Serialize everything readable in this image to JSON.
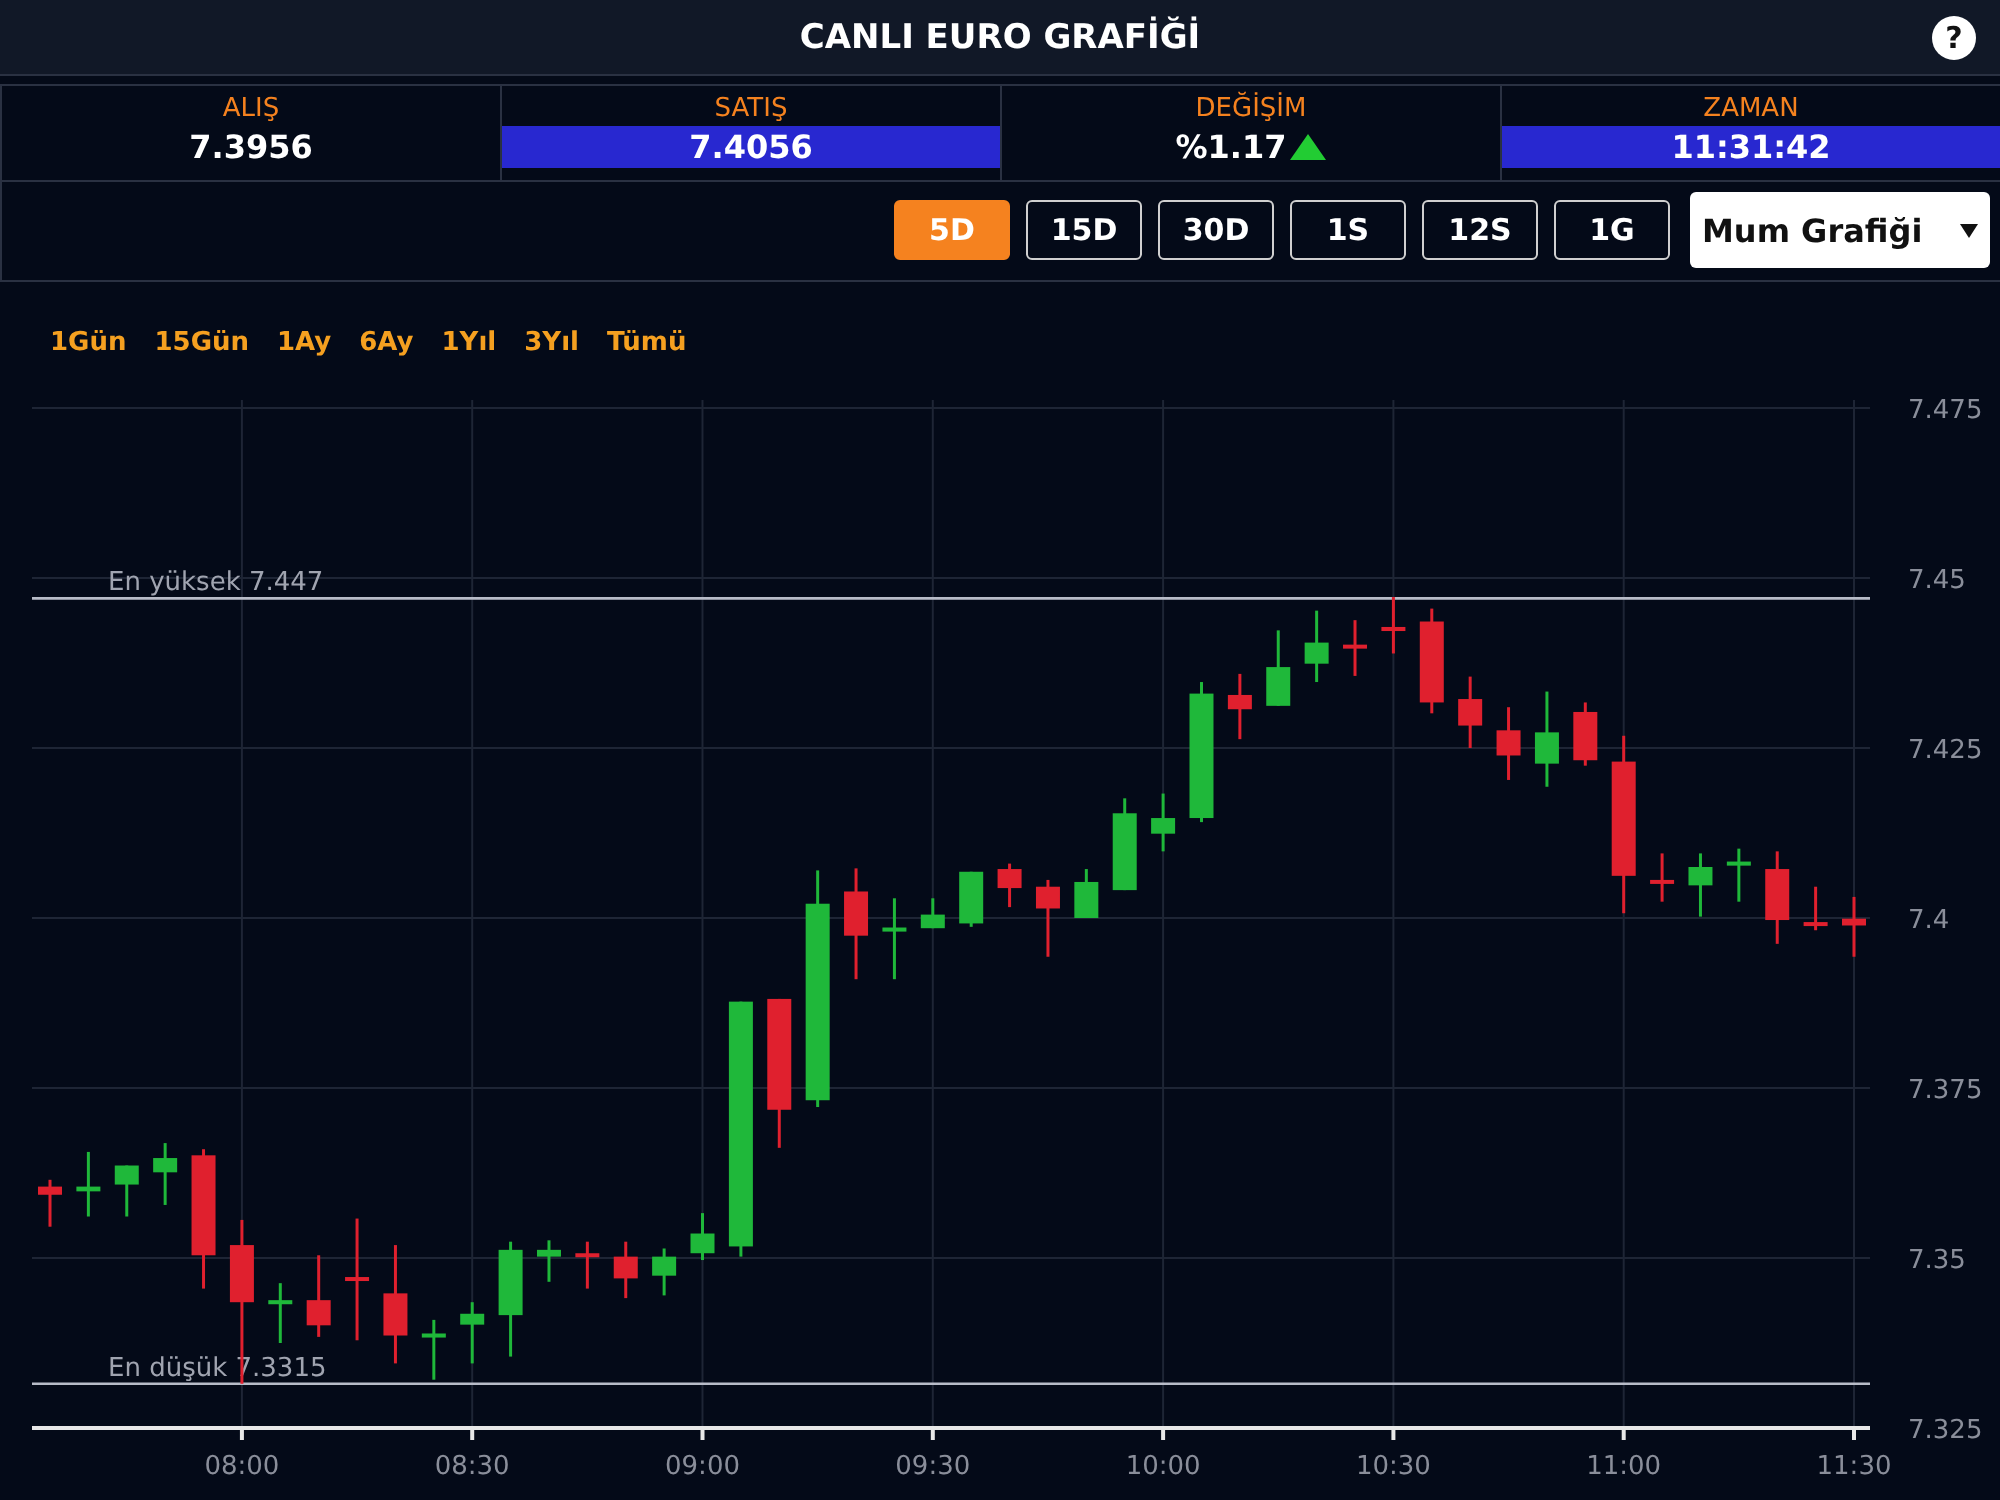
{
  "header": {
    "title": "CANLI EURO GRAFİĞİ",
    "help": "?"
  },
  "quotes": [
    {
      "label": "ALIŞ",
      "value": "7.3956",
      "highlighted": false
    },
    {
      "label": "SATIŞ",
      "value": "7.4056",
      "highlighted": true
    },
    {
      "label": "DEĞİŞİM",
      "value": "%1.17",
      "highlighted": false,
      "rising": true
    },
    {
      "label": "ZAMAN",
      "value": "11:31:42",
      "highlighted": true
    }
  ],
  "periods": [
    {
      "label": "5D",
      "selected": true
    },
    {
      "label": "15D",
      "selected": false
    },
    {
      "label": "30D",
      "selected": false
    },
    {
      "label": "1S",
      "selected": false
    },
    {
      "label": "12S",
      "selected": false
    },
    {
      "label": "1G",
      "selected": false
    }
  ],
  "chart_type": {
    "value": "Mum Grafiği"
  },
  "ranges": [
    "1Gün",
    "15Gün",
    "1Ay",
    "6Ay",
    "1Yıl",
    "3Yıl",
    "Tümü"
  ],
  "chart_data": {
    "type": "candlestick",
    "ylim": [
      7.325,
      7.475
    ],
    "grid": true,
    "categories": [
      null,
      null,
      null,
      null,
      null,
      "08:00",
      null,
      null,
      null,
      null,
      null,
      "08:30",
      null,
      null,
      null,
      null,
      null,
      "09:00",
      null,
      null,
      null,
      null,
      null,
      "09:30",
      null,
      null,
      null,
      null,
      null,
      "10:00",
      null,
      null,
      null,
      null,
      null,
      "10:30",
      null,
      null,
      null,
      null,
      null,
      "11:00",
      null,
      null,
      null,
      null,
      null,
      "11:30"
    ],
    "ohlc": [
      [
        7.3605,
        7.3615,
        7.3546,
        7.3593
      ],
      [
        7.3598,
        7.3656,
        7.3561,
        7.3605
      ],
      [
        7.3608,
        7.3636,
        7.3561,
        7.3636
      ],
      [
        7.3626,
        7.3669,
        7.3578,
        7.3647
      ],
      [
        7.3651,
        7.366,
        7.3455,
        7.3504
      ],
      [
        7.3519,
        7.3556,
        7.3315,
        7.3435
      ],
      [
        7.3432,
        7.3463,
        7.3375,
        7.3438
      ],
      [
        7.3438,
        7.3504,
        7.3384,
        7.3401
      ],
      [
        7.3472,
        7.3558,
        7.3379,
        7.3468
      ],
      [
        7.3448,
        7.3519,
        7.3345,
        7.3386
      ],
      [
        7.3383,
        7.3409,
        7.3321,
        7.3389
      ],
      [
        7.3402,
        7.3435,
        7.3345,
        7.3418
      ],
      [
        7.3416,
        7.3524,
        7.3355,
        7.3512
      ],
      [
        7.3502,
        7.3526,
        7.3465,
        7.3512
      ],
      [
        7.3507,
        7.3524,
        7.3455,
        7.3502
      ],
      [
        7.3502,
        7.3524,
        7.3441,
        7.347
      ],
      [
        7.3474,
        7.3514,
        7.3445,
        7.3502
      ],
      [
        7.3507,
        7.3566,
        7.3497,
        7.3536
      ],
      [
        7.3517,
        7.3877,
        7.3502,
        7.3877
      ],
      [
        7.3881,
        7.3881,
        7.3662,
        7.3718
      ],
      [
        7.3732,
        7.407,
        7.3722,
        7.4021
      ],
      [
        7.4039,
        7.4073,
        7.391,
        7.3974
      ],
      [
        7.398,
        7.4029,
        7.391,
        7.3986
      ],
      [
        7.3985,
        7.4029,
        7.3985,
        7.4005
      ],
      [
        7.3992,
        7.4068,
        7.3987,
        7.4068
      ],
      [
        7.4072,
        7.408,
        7.4016,
        7.4044
      ],
      [
        7.4046,
        7.4056,
        7.3943,
        7.4014
      ],
      [
        7.4,
        7.4072,
        7.4,
        7.4053
      ],
      [
        7.4041,
        7.4176,
        7.4041,
        7.4154
      ],
      [
        7.4124,
        7.4183,
        7.4098,
        7.4147
      ],
      [
        7.4147,
        7.4347,
        7.4141,
        7.433
      ],
      [
        7.4328,
        7.4359,
        7.4263,
        7.4307
      ],
      [
        7.4312,
        7.4423,
        7.4312,
        7.4369
      ],
      [
        7.4374,
        7.4452,
        7.4347,
        7.4405
      ],
      [
        7.4402,
        7.4438,
        7.4356,
        7.4398
      ],
      [
        7.4428,
        7.4472,
        7.4389,
        7.4422
      ],
      [
        7.4436,
        7.4455,
        7.4301,
        7.4317
      ],
      [
        7.4322,
        7.4355,
        7.425,
        7.4283
      ],
      [
        7.4276,
        7.431,
        7.4203,
        7.4239
      ],
      [
        7.4227,
        7.4333,
        7.4193,
        7.4273
      ],
      [
        7.4303,
        7.4317,
        7.4224,
        7.4232
      ],
      [
        7.423,
        7.4268,
        7.4007,
        7.4062
      ],
      [
        7.4056,
        7.4095,
        7.4024,
        7.4052
      ],
      [
        7.4048,
        7.4095,
        7.4002,
        7.4075
      ],
      [
        7.4077,
        7.4102,
        7.4024,
        7.4083
      ],
      [
        7.4072,
        7.4098,
        7.3962,
        7.3997
      ],
      [
        7.3994,
        7.4046,
        7.3982,
        7.3989
      ],
      [
        7.3999,
        7.4031,
        7.3943,
        7.3989
      ]
    ],
    "yticks": [
      {
        "value": 7.325,
        "label": "7.325"
      },
      {
        "value": 7.35,
        "label": "7.35"
      },
      {
        "value": 7.375,
        "label": "7.375"
      },
      {
        "value": 7.4,
        "label": "7.4"
      },
      {
        "value": 7.425,
        "label": "7.425"
      },
      {
        "value": 7.45,
        "label": "7.45"
      },
      {
        "value": 7.475,
        "label": "7.475"
      }
    ],
    "ref_lines": [
      {
        "axis": "y",
        "value": 7.447,
        "label": "En yüksek 7.447"
      },
      {
        "axis": "y",
        "value": 7.3315,
        "label": "En düşük 7.3315"
      }
    ]
  }
}
